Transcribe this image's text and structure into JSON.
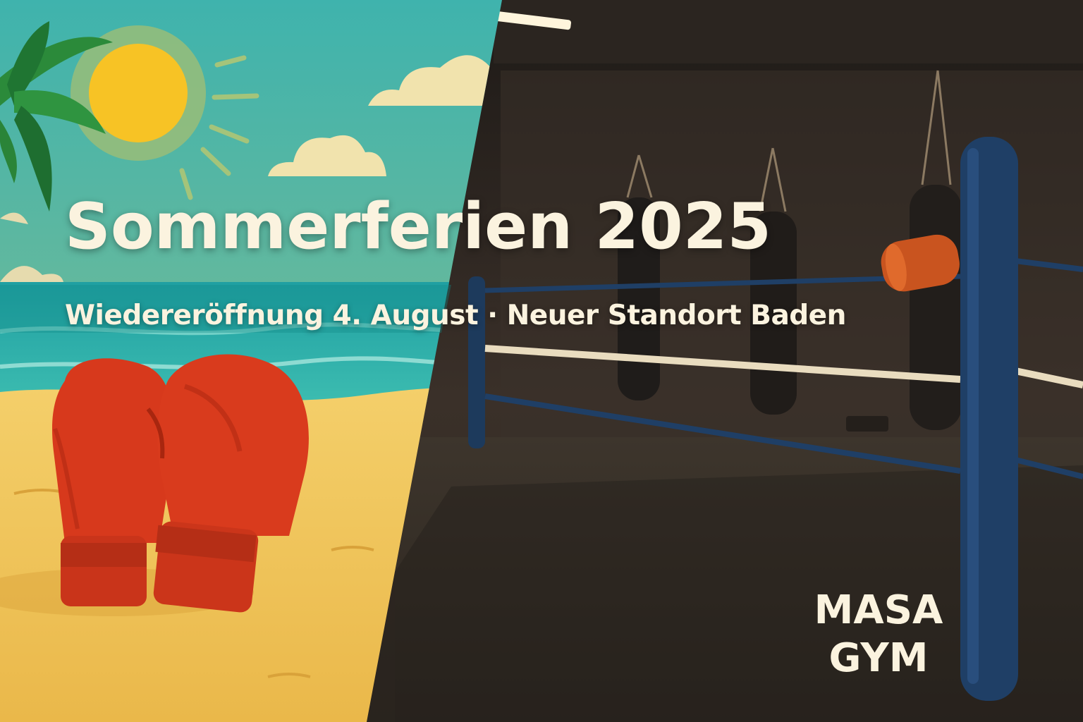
{
  "banner": {
    "headline": "Sommerferien 2025",
    "subline": "Wiedereröffnung 4. August · Neuer Standort Baden",
    "brand_line_1": "MASA",
    "brand_line_2": "GYM"
  },
  "colors": {
    "sky": "#4fb3a6",
    "sea": "#22a7a3",
    "sand": "#f2c55a",
    "sun": "#f7c325",
    "gloves": "#d7391c",
    "gym_dark": "#2a241f",
    "ring_post": "#1f3f66",
    "corner_pad": "#c9541f",
    "text": "#fbf3df"
  }
}
